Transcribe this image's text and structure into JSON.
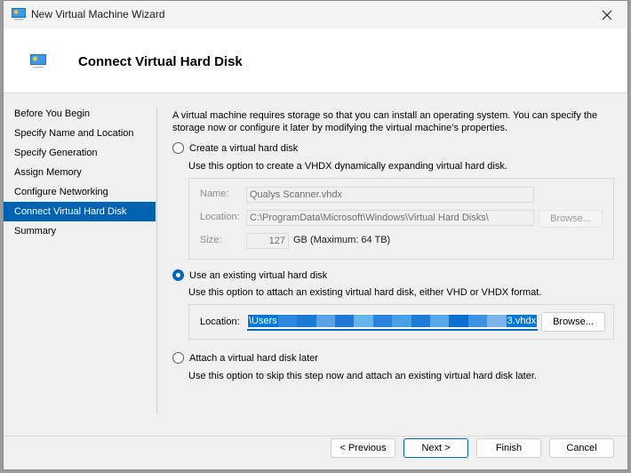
{
  "window": {
    "title": "New Virtual Machine Wizard",
    "close_icon": "close-icon"
  },
  "header": {
    "title": "Connect Virtual Hard Disk",
    "icon": "virtual-machine-icon"
  },
  "nav": {
    "items": [
      {
        "label": "Before You Begin",
        "active": false
      },
      {
        "label": "Specify Name and Location",
        "active": false
      },
      {
        "label": "Specify Generation",
        "active": false
      },
      {
        "label": "Assign Memory",
        "active": false
      },
      {
        "label": "Configure Networking",
        "active": false
      },
      {
        "label": "Connect Virtual Hard Disk",
        "active": true
      },
      {
        "label": "Summary",
        "active": false
      }
    ]
  },
  "content": {
    "intro_line1": "A virtual machine requires storage so that you can install an operating system. You can specify the",
    "intro_line2": "storage now or configure it later by modifying the virtual machine’s properties.",
    "options": {
      "create": {
        "label": "Create a virtual hard disk",
        "description": "Use this option to create a VHDX dynamically expanding virtual hard disk.",
        "checked": false,
        "name_label": "Name:",
        "name_value": "Qualys Scanner.vhdx",
        "location_label": "Location:",
        "location_value": "C:\\ProgramData\\Microsoft\\Windows\\Virtual Hard Disks\\",
        "browse_label": "Browse...",
        "size_label": "Size:",
        "size_value": "127",
        "size_unit": "GB (Maximum: 64 TB)"
      },
      "existing": {
        "label": "Use an existing virtual hard disk",
        "description": "Use this option to attach an existing virtual hard disk, either VHD or VHDX format.",
        "checked": true,
        "location_label": "Location:",
        "location_prefix": "\\Users",
        "location_suffix": "3.vhdx",
        "location_redacted": true,
        "browse_label": "Browse..."
      },
      "later": {
        "label": "Attach a virtual hard disk later",
        "description": "Use this option to skip this step now and attach an existing virtual hard disk later.",
        "checked": false
      }
    }
  },
  "footer": {
    "previous_label": "< Previous",
    "next_label": "Next >",
    "finish_label": "Finish",
    "cancel_label": "Cancel"
  },
  "colors": {
    "accent": "#0067c0",
    "selection": "#0063b1"
  }
}
